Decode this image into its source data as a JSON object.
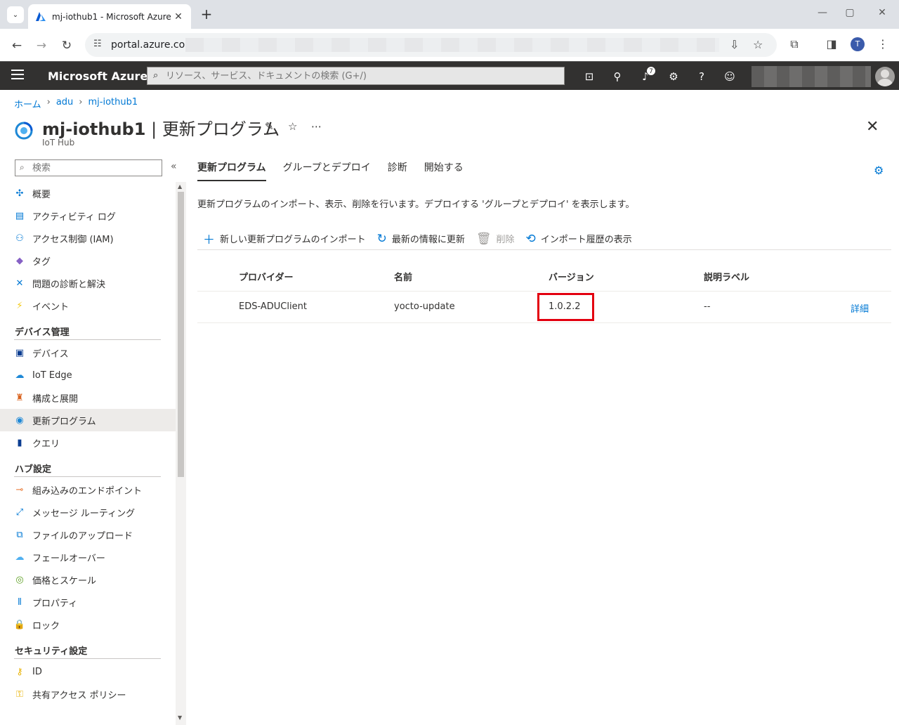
{
  "browser": {
    "tab_title": "mj-iothub1 - Microsoft Azure",
    "url": "portal.azure.com/",
    "profile_initial": "T"
  },
  "azure": {
    "brand": "Microsoft Azure",
    "search_placeholder": "リソース、サービス、ドキュメントの検索 (G+/)",
    "notification_count": "7"
  },
  "breadcrumb": [
    "ホーム",
    "adu",
    "mj-iothub1"
  ],
  "page": {
    "resource_name": "mj-iothub1",
    "separator": "|",
    "section": "更新プログラム",
    "subtitle": "IoT Hub"
  },
  "sidebar": {
    "search_placeholder": "検索",
    "items_top": [
      {
        "label": "概要",
        "icon": "overview-icon"
      },
      {
        "label": "アクティビティ ログ",
        "icon": "activity-log-icon"
      },
      {
        "label": "アクセス制御 (IAM)",
        "icon": "iam-icon"
      },
      {
        "label": "タグ",
        "icon": "tag-icon"
      },
      {
        "label": "問題の診断と解決",
        "icon": "diagnose-icon"
      },
      {
        "label": "イベント",
        "icon": "event-icon"
      }
    ],
    "group_device": "デバイス管理",
    "items_device": [
      {
        "label": "デバイス",
        "icon": "device-icon"
      },
      {
        "label": "IoT Edge",
        "icon": "iot-edge-icon"
      },
      {
        "label": "構成と展開",
        "icon": "configuration-icon"
      },
      {
        "label": "更新プログラム",
        "icon": "updates-icon",
        "active": true
      },
      {
        "label": "クエリ",
        "icon": "query-icon"
      }
    ],
    "group_hub": "ハブ設定",
    "items_hub": [
      {
        "label": "組み込みのエンドポイント",
        "icon": "endpoint-icon"
      },
      {
        "label": "メッセージ ルーティング",
        "icon": "routing-icon"
      },
      {
        "label": "ファイルのアップロード",
        "icon": "file-upload-icon"
      },
      {
        "label": "フェールオーバー",
        "icon": "failover-icon"
      },
      {
        "label": "価格とスケール",
        "icon": "pricing-icon"
      },
      {
        "label": "プロパティ",
        "icon": "properties-icon"
      },
      {
        "label": "ロック",
        "icon": "lock-icon"
      }
    ],
    "group_security": "セキュリティ設定",
    "items_security": [
      {
        "label": "ID",
        "icon": "identity-icon"
      },
      {
        "label": "共有アクセス ポリシー",
        "icon": "key-icon"
      }
    ]
  },
  "tabs": [
    "更新プログラム",
    "グループとデプロイ",
    "診断",
    "開始する"
  ],
  "description": "更新プログラムのインポート、表示、削除を行います。デプロイする 'グループとデプロイ' を表示します。",
  "commands": {
    "import": "新しい更新プログラムのインポート",
    "refresh": "最新の情報に更新",
    "delete": "削除",
    "history": "インポート履歴の表示"
  },
  "table": {
    "headers": [
      "プロバイダー",
      "名前",
      "バージョン",
      "説明ラベル"
    ],
    "rows": [
      {
        "provider": "EDS-ADUClient",
        "name": "yocto-update",
        "version": "1.0.2.2",
        "label": "--",
        "action": "詳細"
      }
    ]
  },
  "colors": {
    "accent": "#0078d4",
    "header_bg": "#323130",
    "highlight": "#e3000f"
  }
}
